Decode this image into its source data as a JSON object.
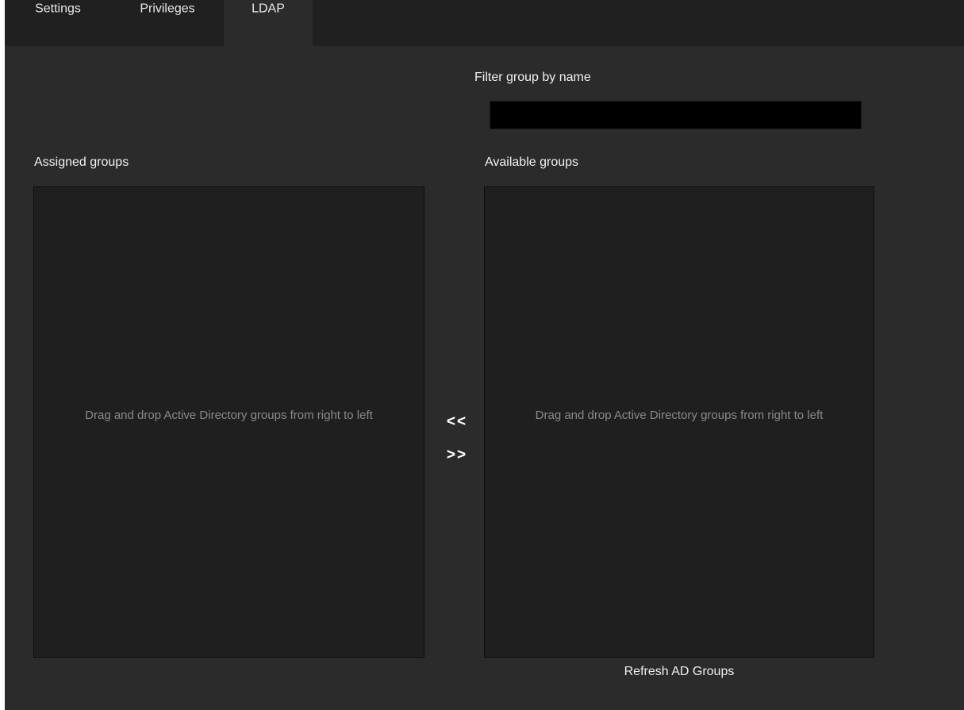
{
  "tabs": [
    {
      "label": "Settings",
      "active": false
    },
    {
      "label": "Privileges",
      "active": false
    },
    {
      "label": "LDAP",
      "active": true
    }
  ],
  "filter": {
    "label": "Filter group by name",
    "value": "",
    "placeholder": ""
  },
  "assigned": {
    "label": "Assigned groups",
    "hint": "Drag and drop Active Directory groups from right to left"
  },
  "available": {
    "label": "Available groups",
    "hint": "Drag and drop Active Directory groups from right to left"
  },
  "controls": {
    "move_left": "<<",
    "move_right": ">>",
    "refresh": "Refresh AD Groups"
  },
  "colors": {
    "background": "#2b2b2b",
    "tabbar": "#202020",
    "panel": "#1f1f1f",
    "input": "#000000",
    "text": "#f0f0f0",
    "hint_text": "#8a8a8a"
  }
}
